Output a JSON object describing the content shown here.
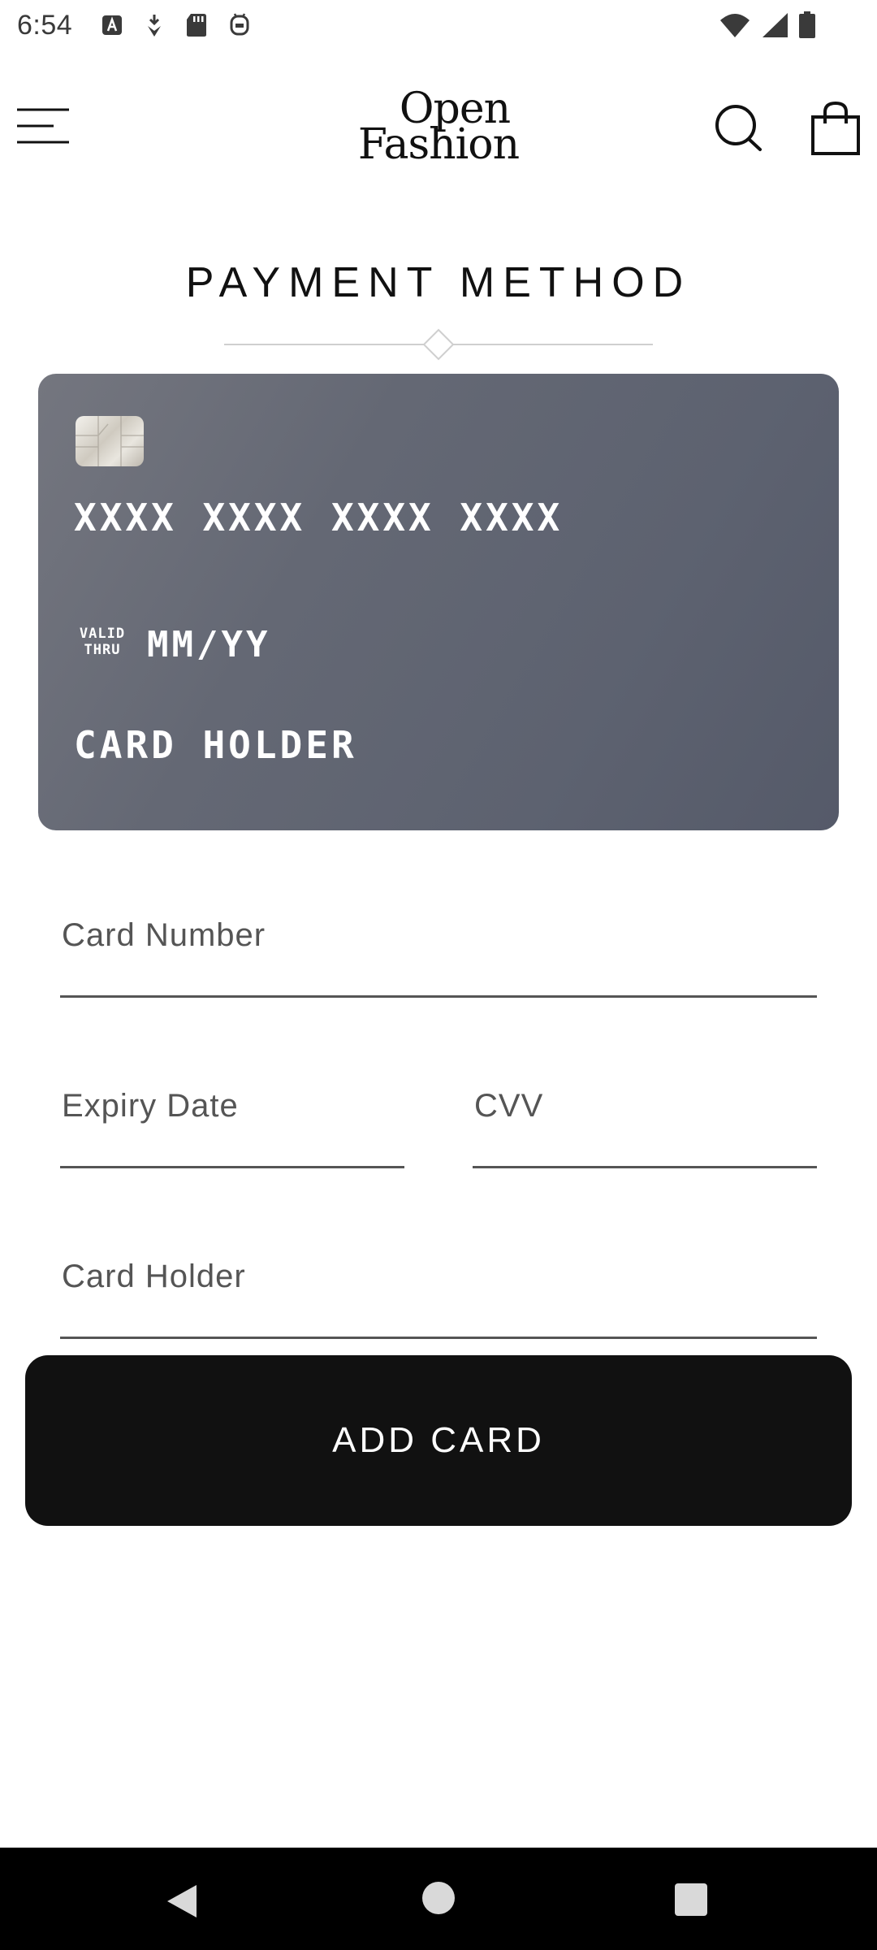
{
  "status_bar": {
    "time": "6:54",
    "left_icons": [
      "font-a-icon",
      "download-icon",
      "sd-card-icon",
      "android-icon"
    ],
    "right_icons": [
      "wifi-icon",
      "cell-signal-icon",
      "battery-icon"
    ]
  },
  "header": {
    "logo_line1": "Open",
    "logo_line2": "Fashion",
    "icons": [
      "menu-icon",
      "search-icon",
      "shopping-bag-icon"
    ]
  },
  "page": {
    "title": "PAYMENT METHOD"
  },
  "card_preview": {
    "number": "XXXX XXXX XXXX XXXX",
    "valid_label_1": "VALID",
    "valid_label_2": "THRU",
    "expiry": "MM/YY",
    "holder": "CARD HOLDER"
  },
  "form": {
    "card_number_placeholder": "Card Number",
    "expiry_placeholder": "Expiry Date",
    "cvv_placeholder": "CVV",
    "holder_placeholder": "Card Holder",
    "submit_label": "ADD CARD"
  },
  "colors": {
    "card_gradient_start": "#74767f",
    "card_gradient_end": "#555a69",
    "button_bg": "#111111",
    "nav_bar_bg": "#000000"
  }
}
